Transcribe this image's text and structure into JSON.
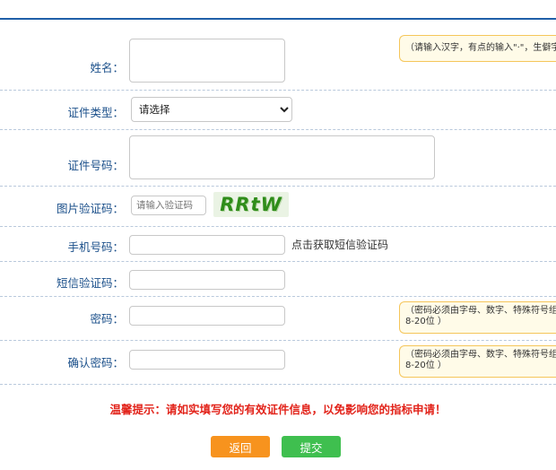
{
  "form": {
    "name": {
      "label": "姓名：",
      "value": "",
      "tip": "（请输入汉字，有点的输入\"·\"，生僻字"
    },
    "cert_type": {
      "label": "证件类型：",
      "selected": "请选择"
    },
    "cert_number": {
      "label": "证件号码：",
      "value": ""
    },
    "image_captcha": {
      "label": "图片验证码：",
      "placeholder": "请输入验证码",
      "code": "RRtW"
    },
    "phone": {
      "label": "手机号码：",
      "value": "",
      "link": "点击获取短信验证码"
    },
    "sms_code": {
      "label": "短信验证码：",
      "value": ""
    },
    "password": {
      "label": "密码：",
      "value": "",
      "tip_line1": "（密码必须由字母、数字、特殊符号组",
      "tip_line2": "8-20位 ）"
    },
    "confirm_password": {
      "label": "确认密码：",
      "value": "",
      "tip_line1": "（密码必须由字母、数字、特殊符号组",
      "tip_line2": "8-20位 ）"
    }
  },
  "notice": "温馨提示：请如实填写您的有效证件信息，以免影响您的指标申请！",
  "buttons": {
    "back": "返回",
    "submit": "提交"
  },
  "colors": {
    "accent": "#1f5fa8",
    "label": "#1a4f8a",
    "back": "#f7931e",
    "submit": "#3fbf4f",
    "notice": "#e2231a"
  }
}
